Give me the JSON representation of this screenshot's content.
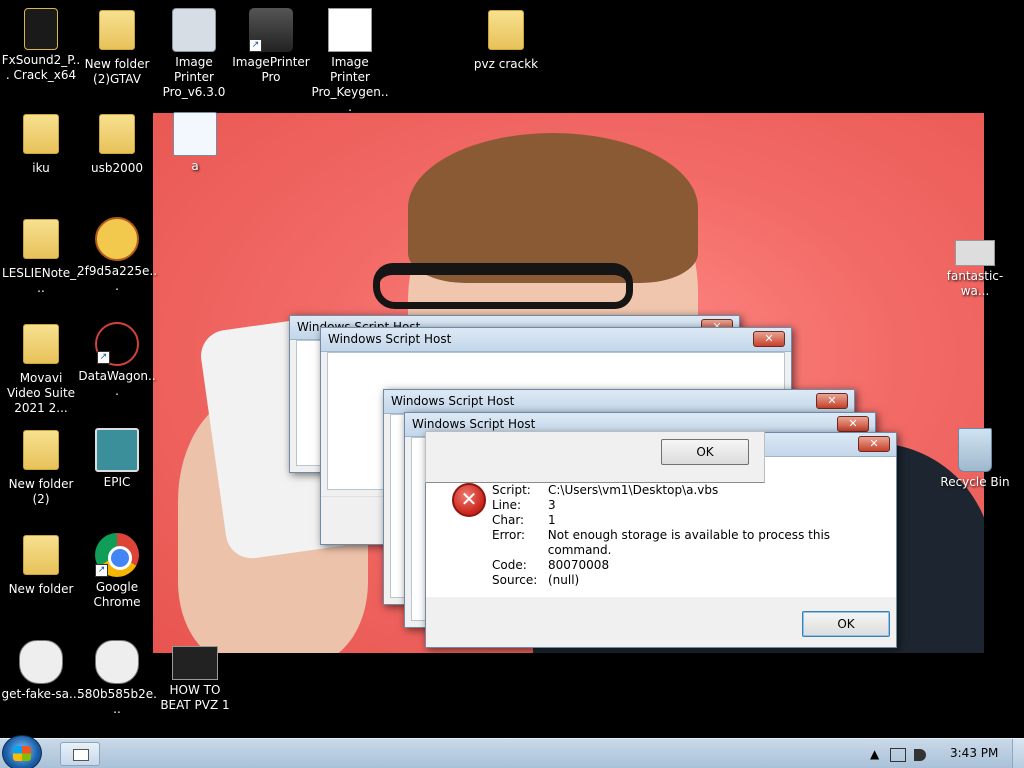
{
  "desktop": {
    "icons": [
      {
        "label": "FxSound2_P... Crack_x64"
      },
      {
        "label": "New folder (2)GTAV"
      },
      {
        "label": "Image Printer Pro_v6.3.0"
      },
      {
        "label": "ImagePrinter Pro"
      },
      {
        "label": "Image Printer Pro_Keygen..."
      },
      {
        "label": "pvz crackk"
      },
      {
        "label": "iku"
      },
      {
        "label": "usb2000"
      },
      {
        "label": "a"
      },
      {
        "label": "LESLIENote_..."
      },
      {
        "label": "2f9d5a225e..."
      },
      {
        "label": "fantastic-wa..."
      },
      {
        "label": "Movavi Video Suite 2021 2..."
      },
      {
        "label": "DataWagon..."
      },
      {
        "label": "New folder (2)"
      },
      {
        "label": "EPIC"
      },
      {
        "label": "Recycle Bin"
      },
      {
        "label": "New folder"
      },
      {
        "label": "Google Chrome"
      },
      {
        "label": "get-fake-sa..."
      },
      {
        "label": "580b585b2e..."
      },
      {
        "label": "HOW TO BEAT PVZ 1"
      }
    ]
  },
  "dialogs": [
    {
      "title": "Windows Script Host",
      "close": "✕"
    },
    {
      "title": "Windows Script Host",
      "close": "✕"
    },
    {
      "title": "Windows Script Host",
      "close": "✕"
    },
    {
      "title": "Windows Script Host",
      "close": "✕"
    },
    {
      "title": "",
      "close": "✕"
    }
  ],
  "ok_label": "OK",
  "error": {
    "fields": [
      {
        "key": "Script:",
        "value": "C:\\Users\\vm1\\Desktop\\a.vbs"
      },
      {
        "key": "Line:",
        "value": "3"
      },
      {
        "key": "Char:",
        "value": "1"
      },
      {
        "key": "Error:",
        "value": "Not enough storage is available to process this command."
      },
      {
        "key": "Code:",
        "value": "80070008"
      },
      {
        "key": "Source:",
        "value": "(null)"
      }
    ],
    "icon": "✕"
  },
  "taskbar": {
    "clock": "3:43 PM",
    "tray_arrow": "▲"
  }
}
